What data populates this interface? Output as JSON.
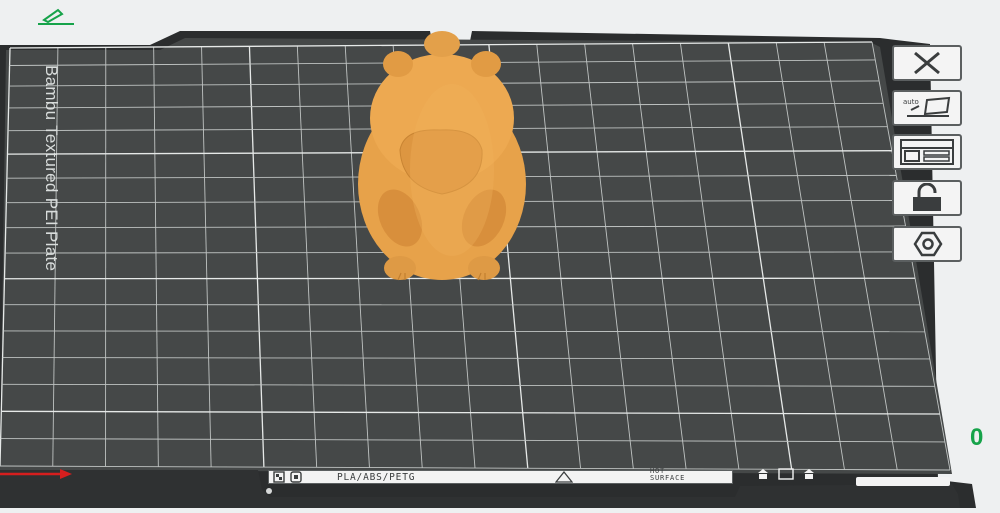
{
  "plate": {
    "name": "Bambu Textured PEI Plate",
    "material_label": "PLA/ABS/PETG",
    "warning_label_line1": "HOT",
    "warning_label_line2": "SURFACE"
  },
  "model": {
    "name": "capybara-model",
    "color": "#e9a44c"
  },
  "side_toolbar": {
    "buttons": [
      {
        "name": "close-icon"
      },
      {
        "name": "auto-arrange-icon",
        "label": "auto"
      },
      {
        "name": "layout-icon"
      },
      {
        "name": "lock-icon"
      },
      {
        "name": "settings-icon"
      }
    ]
  },
  "edit_icon": {
    "name": "pencil-icon",
    "color": "#16a34a"
  },
  "right_indicator": {
    "text": "0",
    "color": "#16a34a"
  },
  "colors": {
    "bed": "#454848",
    "bed_frame": "#2a2c2d",
    "grid": "#cfd3d2",
    "background": "#eef0f1",
    "axis": "#d61e1e"
  }
}
